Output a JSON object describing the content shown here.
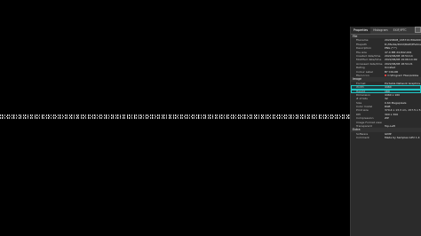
{
  "tabs": [
    "Properties",
    "Histogram",
    "EXIF/IPTC"
  ],
  "file_section": {
    "title": "File",
    "rows": [
      {
        "k": "Filename",
        "v": "20220608_165719 IMG0001.CR2"
      },
      {
        "k": "Filepath",
        "v": "D:/Media/2022/RAW/Photos"
      },
      {
        "k": "Description",
        "v": "PNG (*.*)"
      },
      {
        "k": "File size",
        "v": "47.4 MB 24,842,001"
      },
      {
        "k": "Created date/time",
        "v": "2022/06/08 18:54:14"
      },
      {
        "k": "Modified date/time",
        "v": "2022/06/08 19:06:14:09"
      },
      {
        "k": "Accessed date/time",
        "v": "2022/06/08 18:54:21"
      },
      {
        "k": "Rating",
        "v": "Unrated"
      },
      {
        "k": "Colour Label",
        "v": "BY COLOR"
      },
      {
        "k": "File's Icon",
        "v": "C:\\Program Files\\Adobe"
      }
    ]
  },
  "image_section": {
    "title": "Image",
    "rows": [
      {
        "k": "Format",
        "v": "Portable Network Graphics"
      },
      {
        "k": "Width",
        "v": "4460"
      },
      {
        "k": "Height",
        "v": "160"
      },
      {
        "k": "Dimension",
        "v": "4460 x 160"
      },
      {
        "k": "# of bits",
        "v": "32"
      },
      {
        "k": "Size",
        "v": "0.64 Megapixels"
      },
      {
        "k": "Color model",
        "v": "RGB"
      },
      {
        "k": "Print size",
        "v": "370.4 x 13.3 cm, 157.5 x 5.6 in"
      },
      {
        "k": "DPI",
        "v": "300 x 300"
      },
      {
        "k": "Compression",
        "v": "ZIP"
      },
      {
        "k": "Image Format view",
        "v": ""
      },
      {
        "k": "Transparent",
        "v": "Top-Left"
      }
    ]
  },
  "extra_section": {
    "title": "Extra",
    "rows": [
      {
        "k": "Software",
        "v": "GIMP"
      },
      {
        "k": "Comment",
        "v": "Made by Samples GPU 1.4"
      }
    ]
  },
  "colors": {
    "highlight": "#21c7c7",
    "panel_bg": "#2b2b2b",
    "background": "#000000"
  }
}
